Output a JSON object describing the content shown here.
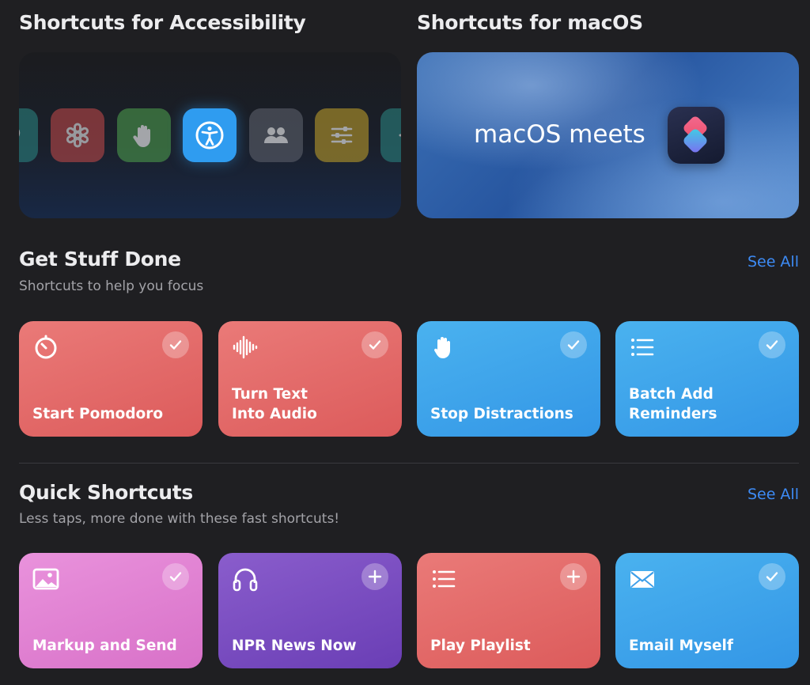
{
  "sections": {
    "accessibility_title": "Shortcuts for Accessibility",
    "macos_title": "Shortcuts for macOS",
    "macos_banner_text": "macOS meets",
    "get_stuff_done": {
      "title": "Get Stuff Done",
      "subtitle": "Shortcuts to help you focus",
      "see_all": "See All"
    },
    "quick_shortcuts": {
      "title": "Quick Shortcuts",
      "subtitle": "Less taps, more done with these fast shortcuts!",
      "see_all": "See All"
    }
  },
  "accessibility_tiles": [
    {
      "icon": "hearing-icon",
      "color": "#2c8a86"
    },
    {
      "icon": "medical-star-icon",
      "color": "#c94b4b"
    },
    {
      "icon": "hand-icon",
      "color": "#4b9a4c"
    },
    {
      "icon": "accessibility-icon",
      "color": "#2f9cf0"
    },
    {
      "icon": "people-icon",
      "color": "#5c606b"
    },
    {
      "icon": "sliders-icon",
      "color": "#b89a2a"
    },
    {
      "icon": "plus-icon",
      "color": "#2c8a86"
    }
  ],
  "get_stuff_done_cards": [
    {
      "label": "Start Pomodoro",
      "icon": "timer-icon",
      "badge": "checkmark",
      "color": "red"
    },
    {
      "label": "Turn Text\nInto Audio",
      "icon": "waveform-icon",
      "badge": "checkmark",
      "color": "red"
    },
    {
      "label": "Stop Distractions",
      "icon": "hand-icon",
      "badge": "checkmark",
      "color": "blue"
    },
    {
      "label": "Batch Add\nReminders",
      "icon": "list-icon",
      "badge": "checkmark",
      "color": "blue"
    }
  ],
  "quick_shortcut_cards": [
    {
      "label": "Markup and Send",
      "icon": "photo-icon",
      "badge": "checkmark",
      "color": "pink"
    },
    {
      "label": "NPR News Now",
      "icon": "headphones-icon",
      "badge": "plus",
      "color": "purple"
    },
    {
      "label": "Play Playlist",
      "icon": "list-icon",
      "badge": "plus",
      "color": "red"
    },
    {
      "label": "Email Myself",
      "icon": "envelope-icon",
      "badge": "checkmark",
      "color": "blue"
    }
  ],
  "colors": {
    "background": "#1f1f22",
    "accent": "#3d8bf5",
    "red_card": "#e06a69",
    "blue_card": "#3da5eb",
    "pink_card": "#e083d3",
    "purple_card": "#7a4dc1"
  }
}
